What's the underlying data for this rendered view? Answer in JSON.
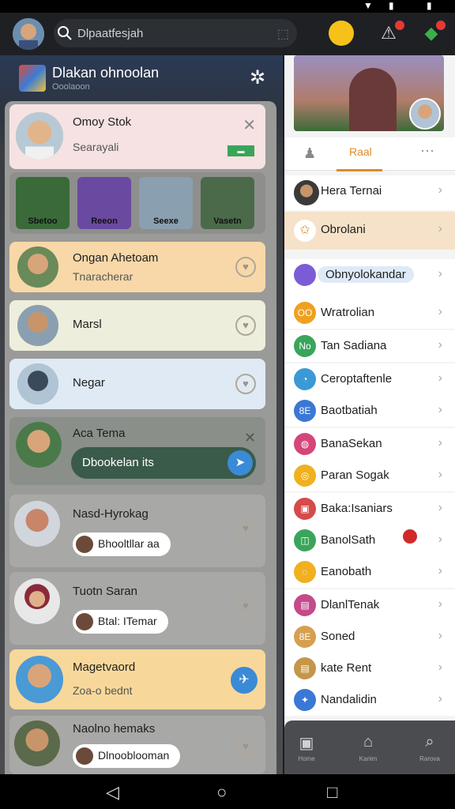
{
  "search": {
    "placeholder": "Dlpaatfesjah"
  },
  "left_header": {
    "title": "Dlakan ohnoolan",
    "subtitle": "Ooolaoon"
  },
  "cards": [
    {
      "name": "Omoy Stok",
      "sub": "Searayali",
      "tag": "▬"
    },
    {
      "name": "Ongan Ahetoam",
      "sub": "Tnaracherar"
    },
    {
      "name": "Marsl"
    },
    {
      "name": "Negar"
    },
    {
      "name": "Aca Tema",
      "pill": "Dbookelan its"
    },
    {
      "name": "Nasd-Hyrokag",
      "pill": "Bhooltllar aa"
    },
    {
      "name": "Tuotn Saran",
      "pill": "Btal: ITemar"
    },
    {
      "name": "Magetvaord",
      "sub": "Zoa-o bednt"
    },
    {
      "name": "Naolno hemaks",
      "pill": "Dlnooblooman"
    }
  ],
  "stories": [
    {
      "label": "Sbetoo"
    },
    {
      "label": "Reeon"
    },
    {
      "label": "Seexe"
    },
    {
      "label": "Vasetn"
    }
  ],
  "right": {
    "tab_label": "Raal",
    "featured": [
      {
        "label": "Hera Ternai"
      },
      {
        "label": "Obrolani"
      }
    ],
    "items": [
      {
        "icon": "Obnyolokandar",
        "label": "Obnyolokandar",
        "color": "#7b5cd6"
      },
      {
        "icon": "OO",
        "label": "Wratrolian",
        "color": "#f0a020"
      },
      {
        "icon": "No",
        "label": "Tan Sadiana",
        "color": "#3aa55a"
      },
      {
        "icon": "◔",
        "label": "Ceroptaftenle",
        "color": "#3a9ad6"
      },
      {
        "icon": "8E",
        "label": "Baotbatiah",
        "color": "#3a78d6"
      },
      {
        "icon": "◍",
        "label": "BanaSekan",
        "color": "#d6457a"
      },
      {
        "icon": "◎",
        "label": "Paran Sogak",
        "color": "#f0b020"
      },
      {
        "icon": "▣",
        "label": "Baka:Isaniars",
        "color": "#d64a4a"
      },
      {
        "icon": "◫",
        "label": "BanolSath",
        "color": "#3aa55a"
      },
      {
        "icon": "◌",
        "label": "Eanobath",
        "color": "#f0b020"
      },
      {
        "icon": "▤",
        "label": "DlanlTenak",
        "color": "#c44a8a"
      },
      {
        "icon": "8E",
        "label": "Soned",
        "color": "#d6a050"
      },
      {
        "icon": "▤",
        "label": "kate Rent",
        "color": "#c4964a"
      },
      {
        "icon": "✦",
        "label": "Nandalidin",
        "color": "#3a78d6"
      }
    ]
  },
  "bottom_nav": [
    {
      "label": "Home"
    },
    {
      "label": "Kanim"
    },
    {
      "label": "Rarova"
    }
  ]
}
